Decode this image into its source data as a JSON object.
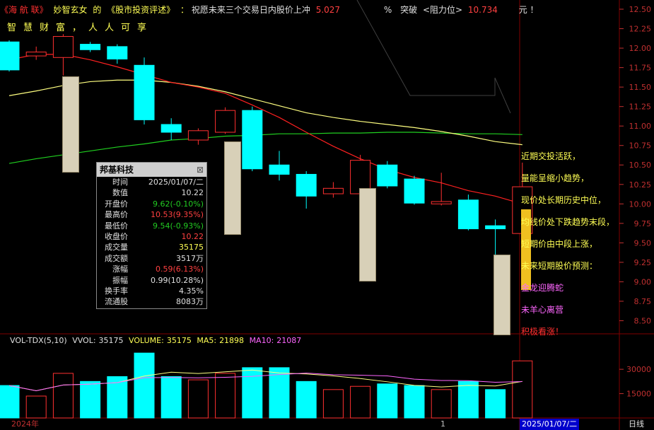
{
  "header": {
    "brand": "《海 航 联》",
    "author": "妙智玄女",
    "de": "的",
    "column": "《股市投资评述》",
    "colon": "：",
    "wish": "祝愿未来三个交易日内股价上冲",
    "wish_value": "5.027",
    "percent": "%",
    "breakthrough": "突破",
    "resistance": "<阻力位>",
    "resistance_value": "10.734",
    "yuan": "元 ！",
    "slogan": "智慧财富，人人可享"
  },
  "price_axis": [
    "12.50",
    "12.25",
    "12.00",
    "11.75",
    "11.50",
    "11.25",
    "11.00",
    "10.75",
    "10.50",
    "10.25",
    "10.00",
    "9.75",
    "9.50",
    "9.25",
    "9.00",
    "8.75",
    "8.50"
  ],
  "volume_axis": [
    "30000",
    "15000"
  ],
  "x_axis": {
    "left_label": "2024年",
    "mid_label": "1",
    "date_badge": "2025/01/07/二",
    "period": "日线"
  },
  "info_panel": {
    "title": "邦基科技",
    "close_glyph": "⊠",
    "rows": [
      {
        "k": "时间",
        "v": "2025/01/07/二",
        "color": "#e0e0e0"
      },
      {
        "k": "数值",
        "v": "10.22",
        "color": "#e0e0e0"
      },
      {
        "k": "开盘价",
        "v": "9.62(-0.10%)",
        "color": "#22cc22"
      },
      {
        "k": "最高价",
        "v": "10.53(9.35%)",
        "color": "#ff4040"
      },
      {
        "k": "最低价",
        "v": "9.54(-0.93%)",
        "color": "#22cc22"
      },
      {
        "k": "收盘价",
        "v": "10.22",
        "color": "#ff4040"
      },
      {
        "k": "成交量",
        "v": "35175",
        "color": "#ffff55"
      },
      {
        "k": "成交额",
        "v": "3517万",
        "color": "#e0e0e0"
      },
      {
        "k": "涨幅",
        "v": "0.59(6.13%)",
        "color": "#ff4040"
      },
      {
        "k": "振幅",
        "v": "0.99(10.28%)",
        "color": "#e0e0e0"
      },
      {
        "k": "换手率",
        "v": "4.35%",
        "color": "#e0e0e0"
      },
      {
        "k": "流通股",
        "v": "8083万",
        "color": "#e0e0e0"
      }
    ]
  },
  "notes": [
    {
      "text": "近期交投活跃，",
      "color": "#ffff55"
    },
    {
      "text": "量能呈缩小趋势，",
      "color": "#ffff55"
    },
    {
      "text": "现价处长期历史中位，",
      "color": "#ffff55"
    },
    {
      "text": "均线价处下跌趋势末段，",
      "color": "#ffff55"
    },
    {
      "text": "短期价由中段上涨，",
      "color": "#ffff55"
    },
    {
      "text": "未来短期股价预测：",
      "color": "#ffff55"
    },
    {
      "text": "金龙迎腾蛇",
      "color": "#ff66ff"
    },
    {
      "text": "未羊心离营",
      "color": "#ff66ff"
    },
    {
      "text": "积极看涨！",
      "color": "#ff3030"
    }
  ],
  "volume_header": {
    "name": "VOL-TDX(5,10)",
    "vvol_label": "VVOL:",
    "vvol_value": "35175",
    "volume_label": "VOLUME:",
    "volume_value": "35175",
    "ma5_label": "MA5:",
    "ma5_value": "21898",
    "ma10_label": "MA10:",
    "ma10_value": "21087"
  },
  "colors": {
    "up": "#ff3030",
    "down": "#00ffff",
    "ma_red": "#ff2020",
    "ma_yellow": "#ffff80",
    "ma_green": "#20d020",
    "grid": "#800000"
  },
  "chart_data": {
    "type": "candlestick",
    "price_range": [
      8.35,
      12.6
    ],
    "candles": [
      {
        "o": 12.08,
        "c": 11.72,
        "h": 12.1,
        "l": 11.7
      },
      {
        "o": 11.9,
        "c": 11.95,
        "h": 12.02,
        "l": 11.85
      },
      {
        "o": 11.88,
        "c": 12.15,
        "h": 12.18,
        "l": 11.65
      },
      {
        "o": 12.05,
        "c": 11.98,
        "h": 12.08,
        "l": 11.95
      },
      {
        "o": 12.02,
        "c": 11.86,
        "h": 12.05,
        "l": 11.8
      },
      {
        "o": 11.78,
        "c": 11.08,
        "h": 11.88,
        "l": 11.02
      },
      {
        "o": 11.02,
        "c": 10.92,
        "h": 11.1,
        "l": 10.82
      },
      {
        "o": 10.82,
        "c": 10.94,
        "h": 10.97,
        "l": 10.76
      },
      {
        "o": 10.92,
        "c": 11.2,
        "h": 11.24,
        "l": 10.9
      },
      {
        "o": 11.2,
        "c": 10.45,
        "h": 11.25,
        "l": 10.42
      },
      {
        "o": 10.5,
        "c": 10.38,
        "h": 10.68,
        "l": 10.3
      },
      {
        "o": 10.38,
        "c": 10.1,
        "h": 10.42,
        "l": 9.94
      },
      {
        "o": 10.13,
        "c": 10.2,
        "h": 10.28,
        "l": 10.08
      },
      {
        "o": 10.13,
        "c": 10.56,
        "h": 10.63,
        "l": 10.12
      },
      {
        "o": 10.5,
        "c": 10.23,
        "h": 10.55,
        "l": 10.2
      },
      {
        "o": 10.32,
        "c": 10.01,
        "h": 10.36,
        "l": 9.99
      },
      {
        "o": 10.0,
        "c": 10.03,
        "h": 10.4,
        "l": 9.98
      },
      {
        "o": 10.05,
        "c": 9.68,
        "h": 10.12,
        "l": 9.66
      },
      {
        "o": 9.72,
        "c": 9.68,
        "h": 9.8,
        "l": 9.17
      },
      {
        "o": 9.62,
        "c": 10.22,
        "h": 10.53,
        "l": 9.54
      }
    ],
    "volume": [
      20000,
      13500,
      27500,
      22500,
      25500,
      40000,
      25500,
      23500,
      27500,
      31000,
      31000,
      22500,
      17500,
      19500,
      21000,
      20000,
      17500,
      22500,
      17500,
      35175
    ],
    "volume_up": [
      false,
      true,
      true,
      false,
      false,
      false,
      false,
      true,
      true,
      false,
      false,
      false,
      true,
      true,
      false,
      false,
      true,
      false,
      false,
      true
    ],
    "volume_range": [
      0,
      44000
    ],
    "ma_red": [
      11.85,
      11.92,
      11.92,
      11.85,
      11.76,
      11.66,
      11.56,
      11.5,
      11.42,
      11.27,
      11.11,
      10.92,
      10.74,
      10.58,
      10.44,
      10.34,
      10.27,
      10.17,
      10.1,
      10.0
    ],
    "ma_yellow": [
      11.39,
      11.45,
      11.52,
      11.57,
      11.59,
      11.59,
      11.56,
      11.51,
      11.44,
      11.35,
      11.26,
      11.17,
      11.11,
      11.06,
      11.02,
      10.98,
      10.93,
      10.87,
      10.8,
      10.76
    ],
    "ma_green": [
      10.52,
      10.58,
      10.63,
      10.68,
      10.73,
      10.77,
      10.82,
      10.84,
      10.87,
      10.88,
      10.9,
      10.9,
      10.91,
      10.91,
      10.92,
      10.92,
      10.91,
      10.9,
      10.9,
      10.89
    ]
  }
}
